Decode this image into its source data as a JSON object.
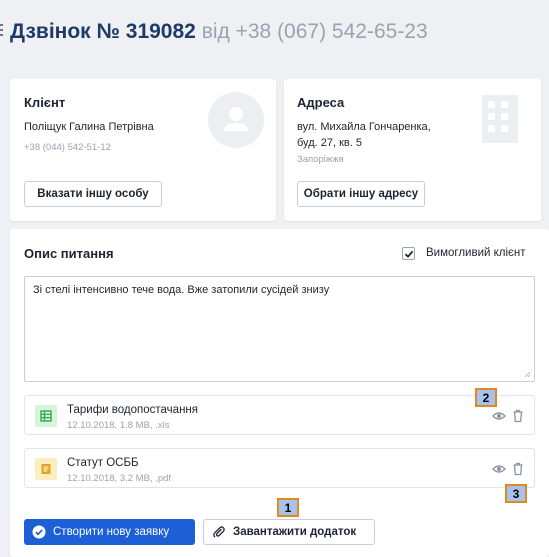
{
  "header": {
    "title_main": "Дзвінок № 319082",
    "title_from": "від",
    "phone": "+38 (067) 542-65-23"
  },
  "client": {
    "title": "Клієнт",
    "name": "Поліщук Галина Петрівна",
    "phone": "+38 (044) 542-51-12",
    "button_label": "Вказати іншу особу",
    "icon": "user-avatar-icon"
  },
  "address": {
    "title": "Адреса",
    "line1": "вул. Михайла Гончаренка,",
    "line2": "буд. 27, кв. 5",
    "city": "Запоріжжя",
    "button_label": "Обрати іншу адресу",
    "icon": "building-icon"
  },
  "issue": {
    "title": "Опис питання",
    "demanding_client_label": "Вимогливий клієнт",
    "demanding_client_checked": true,
    "description": "Зі стелі інтенсивно тече вода. Вже затопили сусідей знизу"
  },
  "attachments": [
    {
      "name": "Тарифи водопостачання",
      "meta": "12.10.2018, 1.8 MB, .xls",
      "icon": "spreadsheet-icon",
      "color": "#d7f3d9",
      "icon_color": "#2aa64a"
    },
    {
      "name": "Статут ОСББ",
      "meta": "12.10.2018, 3.2 MB, .pdf",
      "icon": "document-icon",
      "color": "#fbefc2",
      "icon_color": "#e0a51c"
    }
  ],
  "footer": {
    "create_label": "Створити нову заявку",
    "attach_label": "Завантажити додаток"
  },
  "markers": [
    "1",
    "2",
    "3"
  ],
  "colors": {
    "primary": "#1c5fd6",
    "title": "#1e3a66",
    "muted": "#9aa3b1",
    "marker_fill": "#a8c2ef",
    "marker_border": "#e08a1e"
  }
}
